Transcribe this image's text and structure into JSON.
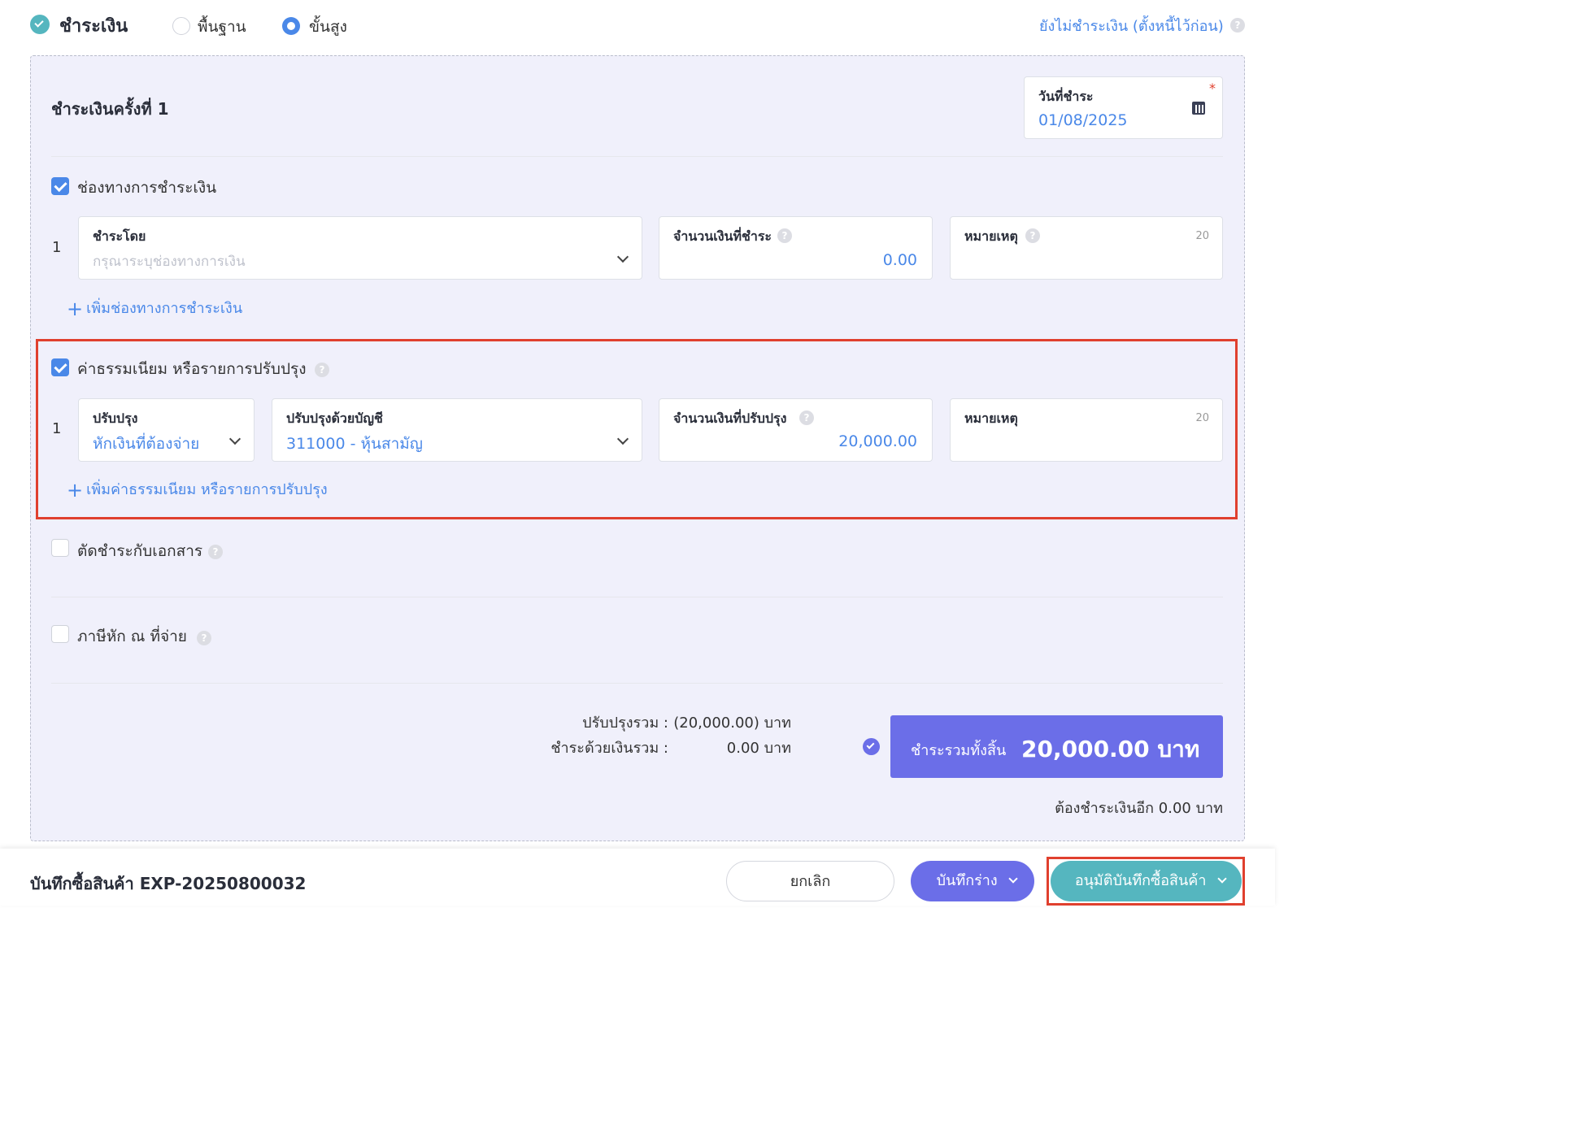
{
  "header": {
    "title": "ชำระเงิน",
    "mode_basic": "พื้นฐาน",
    "mode_advanced": "ขั้นสูง",
    "unpaid_link": "ยังไม่ชำระเงิน (ตั้งหนี้ไว้ก่อน)"
  },
  "payment": {
    "round_title": "ชำระเงินครั้งที่ 1",
    "date_label": "วันที่ชำระ",
    "date_value": "01/08/2025",
    "required_mark": "*"
  },
  "channels": {
    "label": "ช่องทางการชำระเงิน",
    "row_number": "1",
    "pay_by_label": "ชำระโดย",
    "pay_by_placeholder": "กรุณาระบุช่องทางการเงิน",
    "amount_label": "จำนวนเงินที่ชำระ",
    "amount_value": "0.00",
    "note_label": "หมายเหตุ",
    "note_counter": "20",
    "add_link": "เพิ่มช่องทางการชำระเงิน"
  },
  "fees": {
    "label": "ค่าธรรมเนียม หรือรายการปรับปรุง",
    "row_number": "1",
    "adjust_label": "ปรับปรุง",
    "adjust_value": "หักเงินที่ต้องจ่าย",
    "account_label": "ปรับปรุงด้วยบัญชี",
    "account_value": "311000 - หุ้นสามัญ",
    "amount_label": "จำนวนเงินที่ปรับปรุง",
    "amount_value": "20,000.00",
    "note_label": "หมายเหตุ",
    "note_counter": "20",
    "add_link": "เพิ่มค่าธรรมเนียม หรือรายการปรับปรุง"
  },
  "offset": {
    "label": "ตัดชำระกับเอกสาร"
  },
  "withholding": {
    "label": "ภาษีหัก ณ ที่จ่าย"
  },
  "summary": {
    "adjust_total_label": "ปรับปรุงรวม :",
    "adjust_total_value": "(20,000.00) บาท",
    "cash_total_label": "ชำระด้วยเงินรวม :",
    "cash_total_value": "0.00 บาท",
    "grand_label": "ชำระรวมทั้งสิ้น",
    "grand_value": "20,000.00 บาท",
    "remaining": "ต้องชำระเงินอีก 0.00 บาท"
  },
  "footer": {
    "doc_title": "บันทึกซื้อสินค้า EXP-20250800032",
    "cancel": "ยกเลิก",
    "save_draft": "บันทึกร่าง",
    "approve": "อนุมัติบันทึกซื้อสินค้า"
  },
  "colors": {
    "accent": "#4a88e8",
    "grand_total_bg": "#6b6ee8",
    "approve_bg": "#55b6bf",
    "highlight_border": "#e0402e"
  }
}
